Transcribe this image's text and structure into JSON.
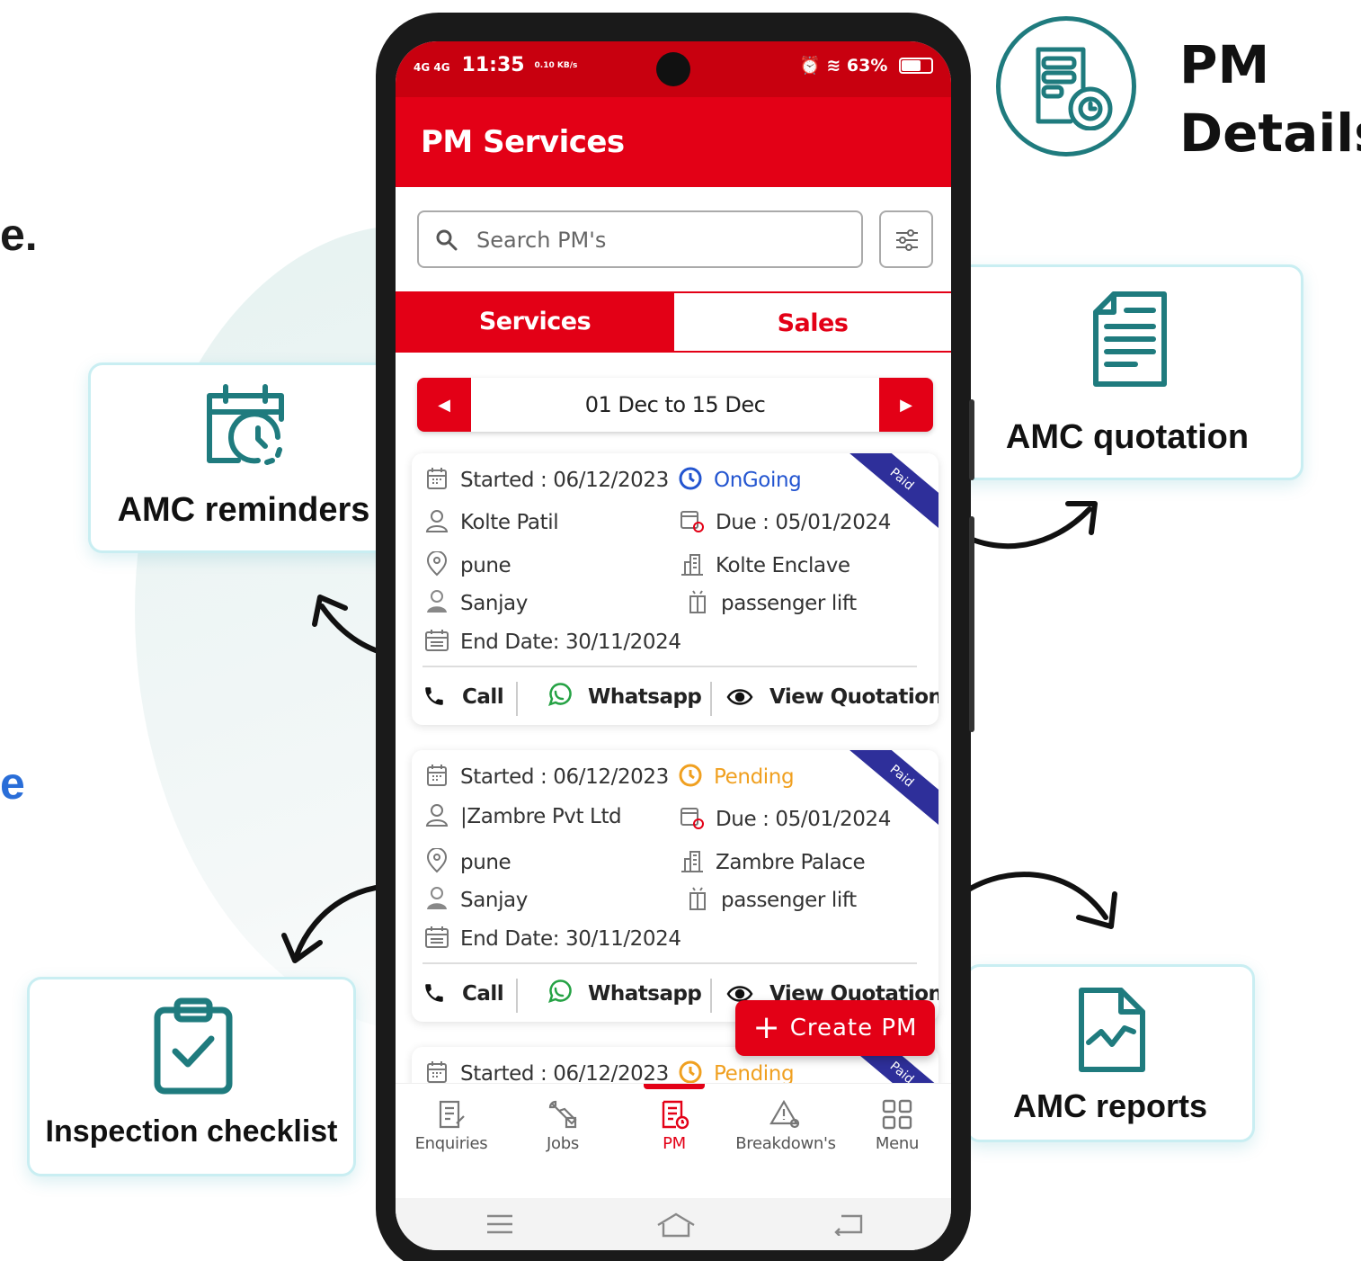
{
  "edge_texts": {
    "top": "e.",
    "middle": "e"
  },
  "heading": {
    "title": "PM\nDetails",
    "icon": "document-clock-icon",
    "color": "#1f7b7e"
  },
  "features": {
    "reminders": {
      "label": "AMC reminders",
      "icon": "calendar-clock-icon"
    },
    "quotation": {
      "label": "AMC quotation",
      "icon": "document-lines-icon"
    },
    "checklist": {
      "label": "Inspection checklist",
      "icon": "clipboard-check-icon"
    },
    "reports": {
      "label": "AMC reports",
      "icon": "document-chart-icon"
    }
  },
  "phone": {
    "status_bar": {
      "network": "4G 4G",
      "time": "11:35",
      "speed": "0.10 KB/s",
      "battery": "63%"
    },
    "app_title": "PM Services",
    "search": {
      "placeholder": "Search PM's",
      "value": ""
    },
    "tabs": {
      "services": "Services",
      "sales": "Sales",
      "active": "Services"
    },
    "date_range": "01 Dec to 15 Dec",
    "cards": [
      {
        "started": "Started : 06/12/2023",
        "status": "OnGoing",
        "ribbon": "Paid",
        "customer": "Kolte Patil",
        "due": "Due : 05/01/2024",
        "location": "pune",
        "site": "Kolte Enclave",
        "technician": "Sanjay",
        "lift_type": "passenger lift",
        "end_date": "End Date: 30/11/2024",
        "actions": {
          "call": "Call",
          "whatsapp": "Whatsapp",
          "view": "View Quotation"
        }
      },
      {
        "started": "Started : 06/12/2023",
        "status": "Pending",
        "ribbon": "Paid",
        "customer": "|Zambre Pvt Ltd",
        "due": "Due : 05/01/2024",
        "location": "pune",
        "site": "Zambre Palace",
        "technician": "Sanjay",
        "lift_type": "passenger lift",
        "end_date": "End Date: 30/11/2024",
        "actions": {
          "call": "Call",
          "whatsapp": "Whatsapp",
          "view": "View Quotation"
        }
      },
      {
        "started": "Started : 06/12/2023",
        "status": "Pending",
        "ribbon": "Paid"
      }
    ],
    "fab": {
      "label": "Create PM"
    },
    "bottom_nav": {
      "enquiries": "Enquiries",
      "jobs": "Jobs",
      "pm": "PM",
      "breakdowns": "Breakdown's",
      "menu": "Menu",
      "active": "PM"
    },
    "colors": {
      "primary": "#e30016",
      "ongoing": "#2355d0",
      "pending": "#f0a020",
      "ribbon": "#2e2f9a"
    }
  }
}
